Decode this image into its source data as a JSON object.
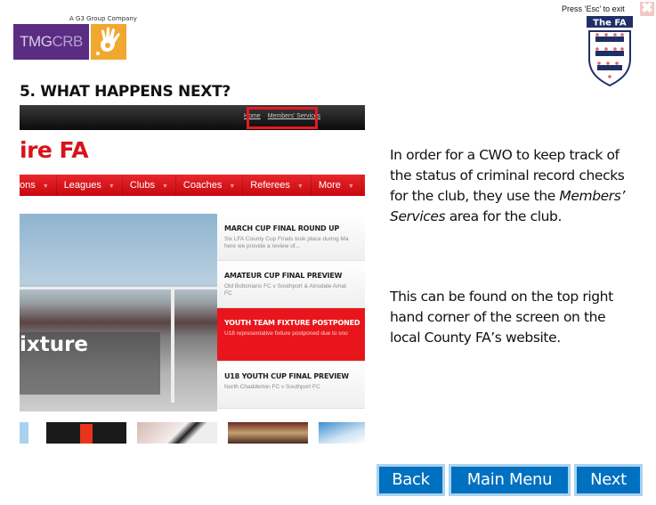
{
  "branding": {
    "parent_company": "A G3 Group Company",
    "logo_text_main": "TMG",
    "logo_text_accent": "CRB",
    "fa_label": "The FA"
  },
  "window": {
    "esc_hint": "Press ‘Esc’ to exit",
    "close_icon": "close-icon"
  },
  "slide": {
    "heading": "5. WHAT HAPPENS NEXT?"
  },
  "website": {
    "top_links": [
      "Home",
      "Members' Services"
    ],
    "brand": "ire FA",
    "menu": [
      "ons",
      "Leagues",
      "Clubs",
      "Coaches",
      "Referees",
      "More"
    ],
    "hero_title": "ixture",
    "news": [
      {
        "title": "MARCH CUP FINAL ROUND UP",
        "desc": "Six LFA County Cup Finals took place during Ma",
        "desc2": "here we provide a review of..."
      },
      {
        "title": "AMATEUR CUP FINAL PREVIEW",
        "desc": "Old Boltonians FC v Southport & Ainsdale Amat",
        "desc2": "FC"
      },
      {
        "title": "YOUTH TEAM FIXTURE POSTPONED",
        "desc": "U18 representative fixture postponed due to sno",
        "desc2": ""
      },
      {
        "title": "U18 YOUTH CUP FINAL PREVIEW",
        "desc": "North Chadderton FC v Southport FC",
        "desc2": ""
      }
    ]
  },
  "content": {
    "para1_before": "In order for a CWO to keep track of the status of criminal record checks for the club, they use the ",
    "para1_em": "Members’ Services",
    "para1_after": " area for the club.",
    "para2": "This can be found on the top right hand corner of the screen on the local County FA’s website."
  },
  "buttons": {
    "back": "Back",
    "main_menu": "Main Menu",
    "next": "Next"
  },
  "colors": {
    "accent_blue": "#0070c0",
    "fa_red": "#e8161c",
    "tmg_purple": "#5a2d82",
    "tmg_orange": "#f0a830"
  }
}
